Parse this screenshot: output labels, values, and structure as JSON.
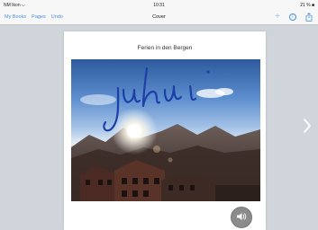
{
  "status_bar": {
    "carrier": "NM Ikon ⌵",
    "time": "10:31",
    "battery": "21 % ■"
  },
  "toolbar": {
    "my_books_label": "My Books",
    "pages_label": "Pages",
    "undo_label": "Undo",
    "title": "Cover",
    "info_label": "i"
  },
  "page": {
    "title": "Ferien in den Bergen",
    "handwriting": "juhui",
    "ink_color": "#1e3fa8"
  },
  "icons": {
    "add": "plus-icon",
    "info": "info-icon",
    "share": "share-icon",
    "sound": "speaker-icon",
    "next": "chevron-right-icon"
  },
  "colors": {
    "accent": "#4a8fe0",
    "background": "#cfd5da"
  }
}
